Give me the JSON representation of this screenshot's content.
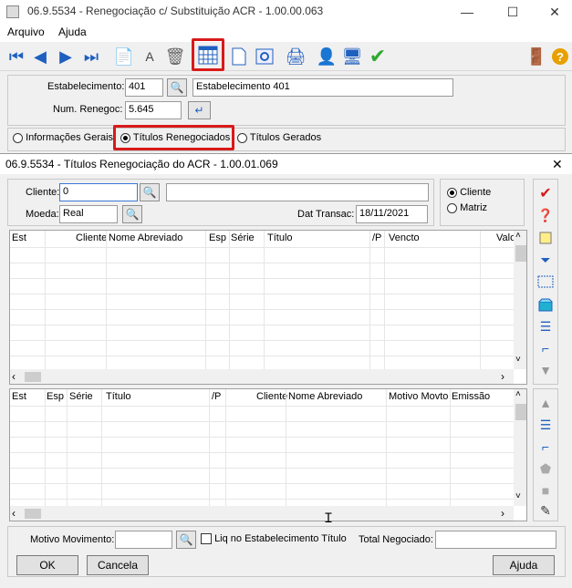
{
  "window": {
    "title": "06.9.5534 - Renegociação c/ Substituição ACR - 1.00.00.063",
    "minimize": "—",
    "maximize": "☐",
    "close": "✕"
  },
  "menu": {
    "arquivo": "Arquivo",
    "ajuda": "Ajuda"
  },
  "header": {
    "estab_label": "Estabelecimento:",
    "estab_value": "401",
    "estab_desc": "Estabelecimento 401",
    "renegoc_label": "Num. Renegoc:",
    "renegoc_value": "5.645"
  },
  "tabs": {
    "info": "Informações Gerais",
    "titulos": "Títulos Renegociados",
    "gerados": "Títulos Gerados"
  },
  "dialog": {
    "title": "06.9.5534 - Títulos Renegociação do ACR - 1.00.01.069",
    "close": "✕",
    "cliente_label": "Cliente:",
    "cliente_value": "0",
    "cliente_desc": "",
    "moeda_label": "Moeda:",
    "moeda_value": "Real",
    "dat_label": "Dat Transac:",
    "dat_value": "18/11/2021",
    "radio_cliente": "Cliente",
    "radio_matriz": "Matriz"
  },
  "grid1": {
    "headers": [
      "Est",
      "Cliente",
      "Nome Abreviado",
      "Esp",
      "Série",
      "Título",
      "/P",
      "Vencto",
      "Valo"
    ]
  },
  "grid2": {
    "headers": [
      "Est",
      "Esp",
      "Série",
      "Título",
      "/P",
      "Cliente",
      "Nome Abreviado",
      "Motivo Movto",
      "Emissão"
    ]
  },
  "footer": {
    "motivo_label": "Motivo Movimento:",
    "motivo_value": "",
    "liq_label": "Liq no Estabelecimento Título",
    "total_label": "Total Negociado:",
    "total_value": "",
    "ok": "OK",
    "cancela": "Cancela",
    "ajuda": "Ajuda"
  }
}
